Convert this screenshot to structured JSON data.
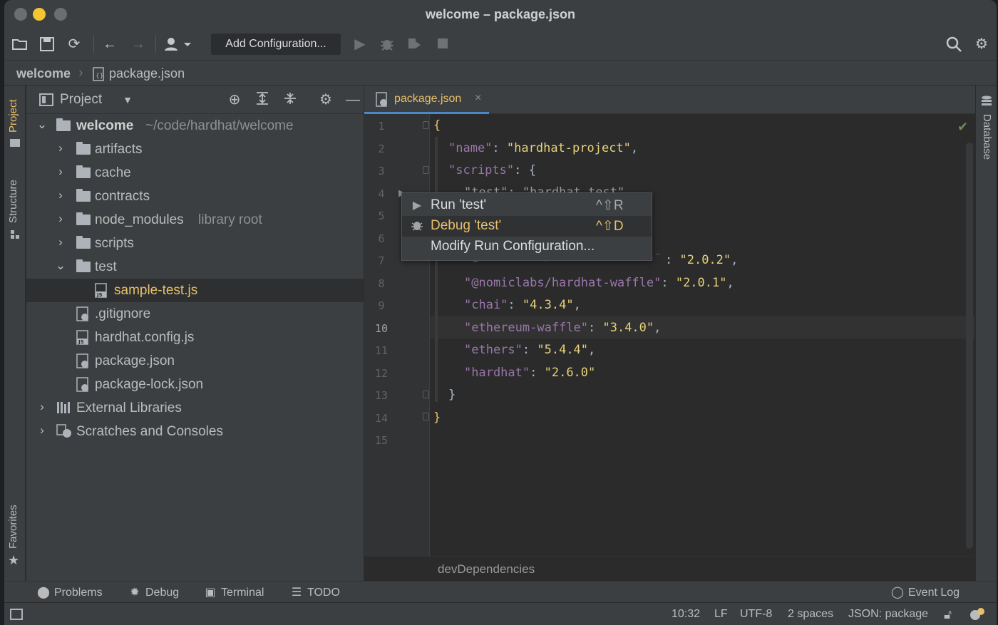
{
  "window": {
    "title": "welcome – package.json"
  },
  "toolbar": {
    "add_configuration": "Add Configuration..."
  },
  "breadcrumb": {
    "root": "welcome",
    "file": "package.json"
  },
  "left_strip": {
    "project_tab": "Project",
    "structure_tab": "Structure",
    "favorites_tab": "Favorites"
  },
  "right_strip": {
    "database_tab": "Database"
  },
  "project": {
    "title": "Project",
    "root_name": "welcome",
    "root_path": "~/code/hardhat/welcome",
    "items": [
      {
        "label": "artifacts"
      },
      {
        "label": "cache"
      },
      {
        "label": "contracts"
      },
      {
        "label": "node_modules",
        "suffix": "library root"
      },
      {
        "label": "scripts"
      },
      {
        "label": "test"
      },
      {
        "label": "sample-test.js"
      },
      {
        "label": ".gitignore"
      },
      {
        "label": "hardhat.config.js"
      },
      {
        "label": "package.json"
      },
      {
        "label": "package-lock.json"
      },
      {
        "label": "External Libraries"
      },
      {
        "label": "Scratches and Consoles"
      }
    ]
  },
  "editor": {
    "tab_label": "package.json",
    "line_numbers": [
      "1",
      "2",
      "3",
      "4",
      "5",
      "6",
      "7",
      "8",
      "9",
      "10",
      "11",
      "12",
      "13",
      "14",
      "15"
    ],
    "current_line": "10",
    "lines": {
      "l1_brace": "{",
      "l2_key": "\"name\"",
      "l2_val": "\"hardhat-project\"",
      "l3_key": "\"scripts\"",
      "l3_rest": ": {",
      "l4_partial": "\"test\": \"hardhat test\"",
      "l7_partial": "\"@nomiclabs/hardhat-ethers\"",
      "l7_val": "\"2.0.2\"",
      "l8_key": "\"@nomiclabs/hardhat-waffle\"",
      "l8_val": "\"2.0.1\"",
      "l9_key": "\"chai\"",
      "l9_val": "\"4.3.4\"",
      "l10_key": "\"ethereum-waffle\"",
      "l10_val": "\"3.4.0\"",
      "l11_key": "\"ethers\"",
      "l11_val": "\"5.4.4\"",
      "l12_key": "\"hardhat\"",
      "l12_val": "\"2.6.0\"",
      "l13_brace": "}",
      "l14_brace": "}"
    },
    "breadcrumb_footer": "devDependencies"
  },
  "popup": {
    "items": [
      {
        "label": "Run 'test'",
        "shortcut": "^⇧R"
      },
      {
        "label": "Debug 'test'",
        "shortcut": "^⇧D"
      },
      {
        "label": "Modify Run Configuration...",
        "shortcut": ""
      }
    ]
  },
  "bottom_tools": {
    "problems": "Problems",
    "debug": "Debug",
    "terminal": "Terminal",
    "todo": "TODO",
    "event_log": "Event Log"
  },
  "status": {
    "position": "10:32",
    "line_sep": "LF",
    "encoding": "UTF-8",
    "indent": "2 spaces",
    "schema": "JSON: package"
  },
  "colors": {
    "accent": "#e8bf6a",
    "string": "#e6d27a",
    "key": "#9876aa",
    "panel": "#3c3f41",
    "editor_bg": "#2b2b2b"
  }
}
